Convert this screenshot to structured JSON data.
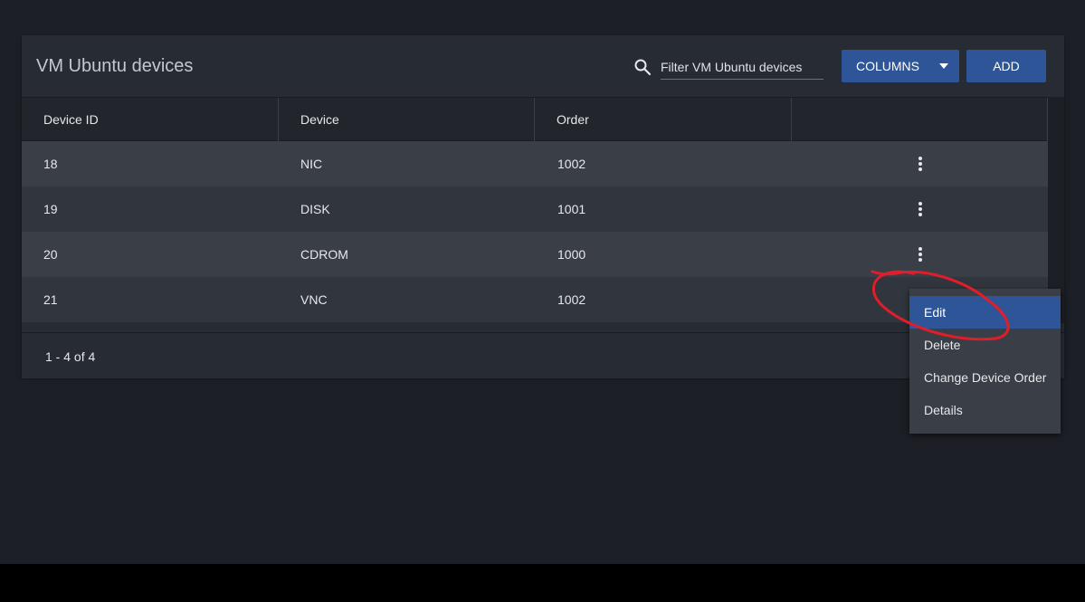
{
  "card": {
    "title": "VM Ubuntu devices",
    "search_icon": "search-icon",
    "filter_placeholder": "Filter VM Ubuntu devices",
    "columns_button": "COLUMNS",
    "add_button": "ADD"
  },
  "table": {
    "headers": [
      "Device ID",
      "Device",
      "Order",
      ""
    ],
    "rows": [
      {
        "id": "18",
        "device": "NIC",
        "order": "1002"
      },
      {
        "id": "19",
        "device": "DISK",
        "order": "1001"
      },
      {
        "id": "20",
        "device": "CDROM",
        "order": "1000"
      },
      {
        "id": "21",
        "device": "VNC",
        "order": "1002"
      }
    ]
  },
  "footer": {
    "pagination": "1 - 4 of 4"
  },
  "context_menu": {
    "items": [
      "Edit",
      "Delete",
      "Change Device Order",
      "Details"
    ],
    "highlighted": "Edit"
  },
  "colors": {
    "background": "#1c1f26",
    "card": "#272b33",
    "accent": "#2d5597",
    "annotation": "#e01e2b"
  }
}
